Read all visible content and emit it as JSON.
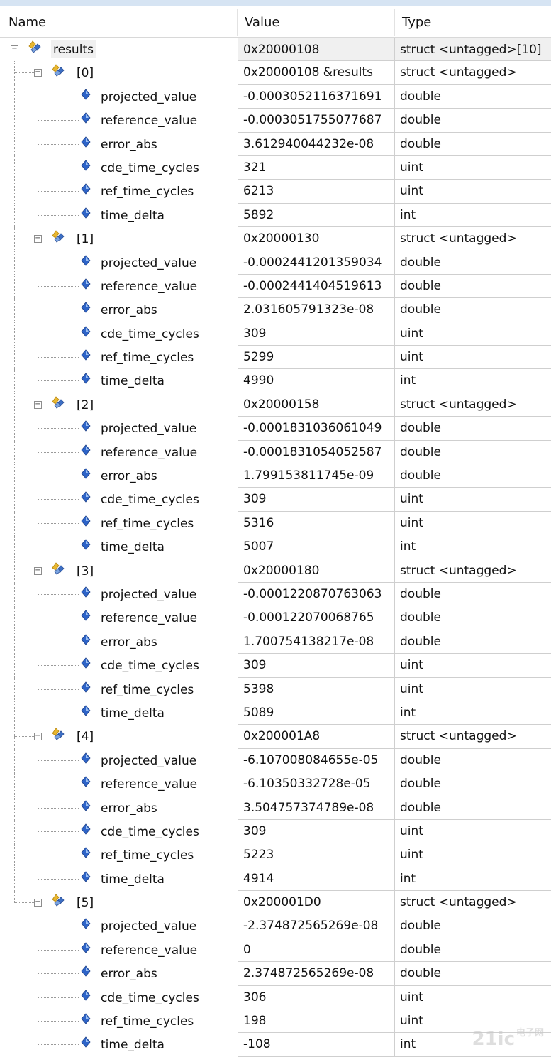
{
  "columns": {
    "name": "Name",
    "value": "Value",
    "type": "Type"
  },
  "rows": [
    {
      "level": 0,
      "kind": "struct",
      "expander": "−",
      "name": "results",
      "value": "0x20000108",
      "type": "struct <untagged>[10]",
      "selected": true
    },
    {
      "level": 1,
      "kind": "struct",
      "expander": "−",
      "name": "[0]",
      "value": "0x20000108 &results",
      "type": "struct <untagged>"
    },
    {
      "level": 2,
      "kind": "field",
      "name": "projected_value",
      "value": "-0.0003052116371691",
      "type": "double"
    },
    {
      "level": 2,
      "kind": "field",
      "name": "reference_value",
      "value": "-0.0003051755077687",
      "type": "double"
    },
    {
      "level": 2,
      "kind": "field",
      "name": "error_abs",
      "value": "3.612940044232e-08",
      "type": "double"
    },
    {
      "level": 2,
      "kind": "field",
      "name": "cde_time_cycles",
      "value": "321",
      "type": "uint"
    },
    {
      "level": 2,
      "kind": "field",
      "name": "ref_time_cycles",
      "value": "6213",
      "type": "uint"
    },
    {
      "level": 2,
      "kind": "field",
      "name": "time_delta",
      "value": "5892",
      "type": "int"
    },
    {
      "level": 1,
      "kind": "struct",
      "expander": "−",
      "name": "[1]",
      "value": "0x20000130",
      "type": "struct <untagged>"
    },
    {
      "level": 2,
      "kind": "field",
      "name": "projected_value",
      "value": "-0.0002441201359034",
      "type": "double"
    },
    {
      "level": 2,
      "kind": "field",
      "name": "reference_value",
      "value": "-0.0002441404519613",
      "type": "double"
    },
    {
      "level": 2,
      "kind": "field",
      "name": "error_abs",
      "value": "2.031605791323e-08",
      "type": "double"
    },
    {
      "level": 2,
      "kind": "field",
      "name": "cde_time_cycles",
      "value": "309",
      "type": "uint"
    },
    {
      "level": 2,
      "kind": "field",
      "name": "ref_time_cycles",
      "value": "5299",
      "type": "uint"
    },
    {
      "level": 2,
      "kind": "field",
      "name": "time_delta",
      "value": "4990",
      "type": "int"
    },
    {
      "level": 1,
      "kind": "struct",
      "expander": "−",
      "name": "[2]",
      "value": "0x20000158",
      "type": "struct <untagged>"
    },
    {
      "level": 2,
      "kind": "field",
      "name": "projected_value",
      "value": "-0.0001831036061049",
      "type": "double"
    },
    {
      "level": 2,
      "kind": "field",
      "name": "reference_value",
      "value": "-0.0001831054052587",
      "type": "double"
    },
    {
      "level": 2,
      "kind": "field",
      "name": "error_abs",
      "value": "1.799153811745e-09",
      "type": "double"
    },
    {
      "level": 2,
      "kind": "field",
      "name": "cde_time_cycles",
      "value": "309",
      "type": "uint"
    },
    {
      "level": 2,
      "kind": "field",
      "name": "ref_time_cycles",
      "value": "5316",
      "type": "uint"
    },
    {
      "level": 2,
      "kind": "field",
      "name": "time_delta",
      "value": "5007",
      "type": "int"
    },
    {
      "level": 1,
      "kind": "struct",
      "expander": "−",
      "name": "[3]",
      "value": "0x20000180",
      "type": "struct <untagged>"
    },
    {
      "level": 2,
      "kind": "field",
      "name": "projected_value",
      "value": "-0.0001220870763063",
      "type": "double"
    },
    {
      "level": 2,
      "kind": "field",
      "name": "reference_value",
      "value": "-0.000122070068765",
      "type": "double"
    },
    {
      "level": 2,
      "kind": "field",
      "name": "error_abs",
      "value": "1.700754138217e-08",
      "type": "double"
    },
    {
      "level": 2,
      "kind": "field",
      "name": "cde_time_cycles",
      "value": "309",
      "type": "uint"
    },
    {
      "level": 2,
      "kind": "field",
      "name": "ref_time_cycles",
      "value": "5398",
      "type": "uint"
    },
    {
      "level": 2,
      "kind": "field",
      "name": "time_delta",
      "value": "5089",
      "type": "int"
    },
    {
      "level": 1,
      "kind": "struct",
      "expander": "−",
      "name": "[4]",
      "value": "0x200001A8",
      "type": "struct <untagged>"
    },
    {
      "level": 2,
      "kind": "field",
      "name": "projected_value",
      "value": "-6.107008084655e-05",
      "type": "double"
    },
    {
      "level": 2,
      "kind": "field",
      "name": "reference_value",
      "value": "-6.10350332728e-05",
      "type": "double"
    },
    {
      "level": 2,
      "kind": "field",
      "name": "error_abs",
      "value": "3.504757374789e-08",
      "type": "double"
    },
    {
      "level": 2,
      "kind": "field",
      "name": "cde_time_cycles",
      "value": "309",
      "type": "uint"
    },
    {
      "level": 2,
      "kind": "field",
      "name": "ref_time_cycles",
      "value": "5223",
      "type": "uint"
    },
    {
      "level": 2,
      "kind": "field",
      "name": "time_delta",
      "value": "4914",
      "type": "int"
    },
    {
      "level": 1,
      "kind": "struct",
      "expander": "−",
      "name": "[5]",
      "value": "0x200001D0",
      "type": "struct <untagged>"
    },
    {
      "level": 2,
      "kind": "field",
      "name": "projected_value",
      "value": "-2.374872565269e-08",
      "type": "double"
    },
    {
      "level": 2,
      "kind": "field",
      "name": "reference_value",
      "value": "0",
      "type": "double"
    },
    {
      "level": 2,
      "kind": "field",
      "name": "error_abs",
      "value": "2.374872565269e-08",
      "type": "double"
    },
    {
      "level": 2,
      "kind": "field",
      "name": "cde_time_cycles",
      "value": "306",
      "type": "uint"
    },
    {
      "level": 2,
      "kind": "field",
      "name": "ref_time_cycles",
      "value": "198",
      "type": "uint"
    },
    {
      "level": 2,
      "kind": "field",
      "name": "time_delta",
      "value": "-108",
      "type": "int"
    }
  ],
  "watermark": {
    "main": "21ic",
    "sub": "电子网"
  },
  "colors": {
    "struct_icon_gold": "#e8b730",
    "struct_icon_blue": "#3d6fc4",
    "field_icon_blue": "#2e64c8",
    "grid": "#cfcfcf",
    "selection": "#f0f0f0"
  }
}
